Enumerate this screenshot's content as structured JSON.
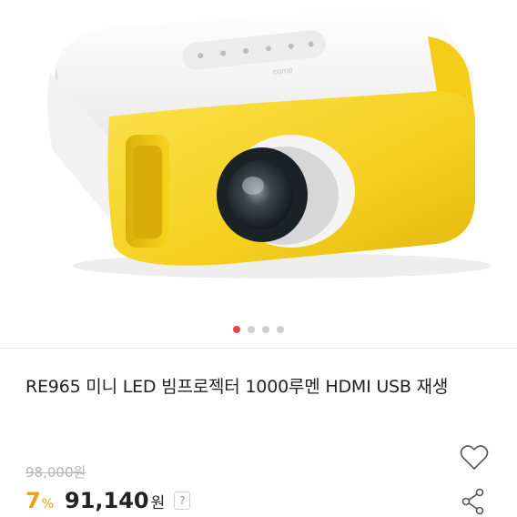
{
  "product": {
    "title": "RE965 미니 LED 빔프로젝터 1000루멘 HDMI USB 재생",
    "original_price": "98,000원",
    "discount_value": "7",
    "discount_unit": "%",
    "price_value": "91,140",
    "price_unit": "원",
    "help_label": "?"
  },
  "gallery": {
    "total_images": 4,
    "active_index": 1,
    "image_alt_icon": "projector-image"
  },
  "colors": {
    "accent_red": "#e8434a",
    "discount_yellow": "#e8a300",
    "projector_yellow": "#f7d31c"
  },
  "icons": {
    "wishlist": "heart-icon",
    "share": "share-icon",
    "help": "question-icon"
  }
}
